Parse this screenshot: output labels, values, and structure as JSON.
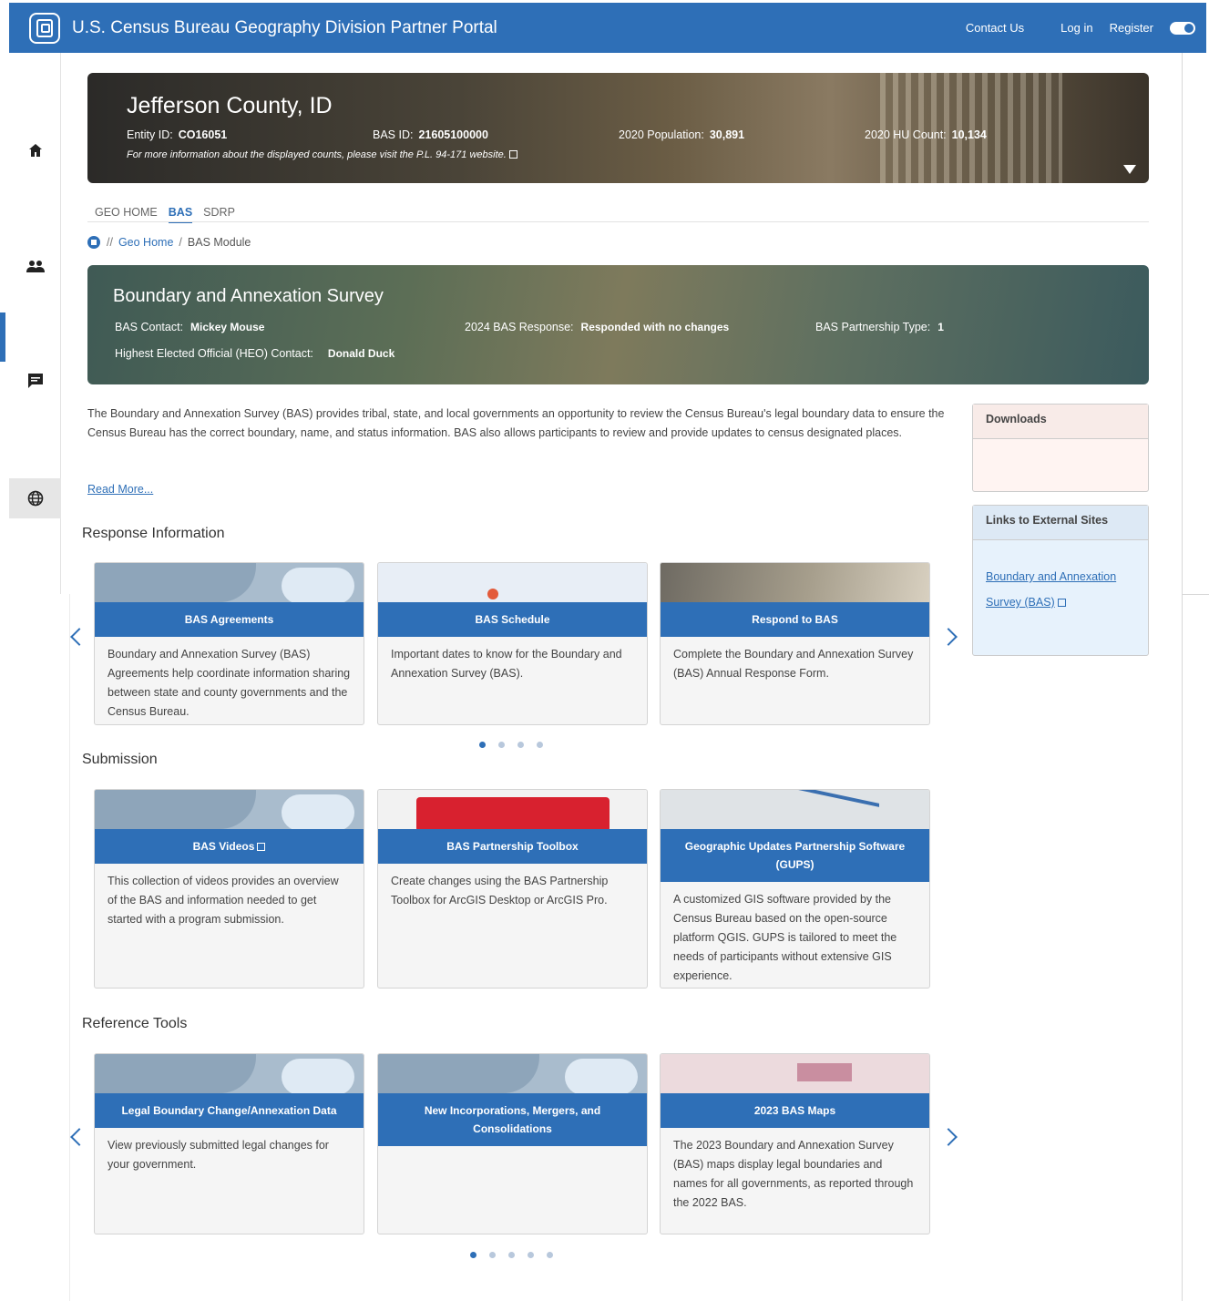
{
  "app": {
    "title": "U.S. Census Bureau Geography Division Partner Portal"
  },
  "header": {
    "contact": "Contact Us",
    "login": "Log in",
    "register": "Register"
  },
  "rail": {
    "icons": [
      "home-icon",
      "people-icon",
      "chat-icon",
      "globe-icon"
    ],
    "active": "globe-icon"
  },
  "county": {
    "name": "Jefferson County, ID",
    "entity_label": "Entity ID:",
    "entity_value": "CO16051",
    "bas_label": "BAS ID:",
    "bas_value": "21605100000",
    "pop_label": "2020 Population:",
    "pop_value": "30,891",
    "hu_label": "2020 HU Count:",
    "hu_value": "10,134",
    "note": "For more information about the displayed counts, please visit the P.L. 94-171 website."
  },
  "tabs": [
    "GEO HOME",
    "BAS",
    "SDRP"
  ],
  "active_tab": "BAS",
  "breadcrumb": {
    "sep1": "//",
    "link": "Geo Home",
    "sep2": "/",
    "current": "BAS Module"
  },
  "bas": {
    "title": "Boundary and Annexation Survey",
    "contact_label": "BAS Contact:",
    "contact_value": "Mickey Mouse",
    "response_label": "2024 BAS Response:",
    "response_value": "Responded with no changes",
    "type_label": "BAS Partnership Type:",
    "type_value": "1",
    "heo_label": "Highest Elected Official (HEO) Contact:",
    "heo_value": "Donald Duck"
  },
  "description": "The Boundary and Annexation Survey (BAS) provides tribal, state, and local governments an opportunity to review the Census Bureau's legal boundary data to ensure the Census Bureau has the correct boundary, name, and status information. BAS also allows participants to review and provide updates to census designated places.",
  "read_more": "Read More...",
  "downloads": {
    "title": "Downloads"
  },
  "links": {
    "title": "Links to External Sites",
    "link": "Boundary and Annexation Survey (BAS)"
  },
  "sections": {
    "response": {
      "title": "Response Information",
      "cards": [
        {
          "title": "BAS Agreements",
          "text": "Boundary and Annexation Survey (BAS) Agreements help coordinate information sharing between state and county governments and the Census Bureau."
        },
        {
          "title": "BAS Schedule",
          "text": "Important dates to know for the Boundary and Annexation Survey (BAS)."
        },
        {
          "title": "Respond to BAS",
          "text": "Complete the Boundary and Annexation Survey (BAS) Annual Response Form."
        }
      ]
    },
    "submission": {
      "title": "Submission",
      "cards": [
        {
          "title": "BAS Videos",
          "text": "This collection of videos provides an overview of the BAS and information needed to get started with a program submission."
        },
        {
          "title": "BAS Partnership Toolbox",
          "text": "Create changes using the BAS Partnership Toolbox for ArcGIS Desktop or ArcGIS Pro."
        },
        {
          "title": "Geographic Updates Partnership Software (GUPS)",
          "text": "A customized GIS software provided by the Census Bureau based on the open-source platform QGIS. GUPS is tailored to meet the needs of participants without extensive GIS experience."
        }
      ]
    },
    "reference": {
      "title": "Reference Tools",
      "cards": [
        {
          "title": "Legal Boundary Change/Annexation Data",
          "text": "View previously submitted legal changes for your government."
        },
        {
          "title": "New Incorporations, Mergers, and Consolidations",
          "text": ""
        },
        {
          "title": "2023 BAS Maps",
          "text": "The 2023 Boundary and Annexation Survey (BAS) maps display legal boundaries and names for all governments, as reported through the 2022 BAS."
        }
      ]
    }
  },
  "carousel": {
    "response_pages": 4,
    "response_active": 1,
    "reference_pages": 5,
    "reference_active": 1
  },
  "colors": {
    "primary": "#2e6fb7",
    "downloads_bg": "#fff4f2",
    "links_bg": "#e7f2fc"
  }
}
